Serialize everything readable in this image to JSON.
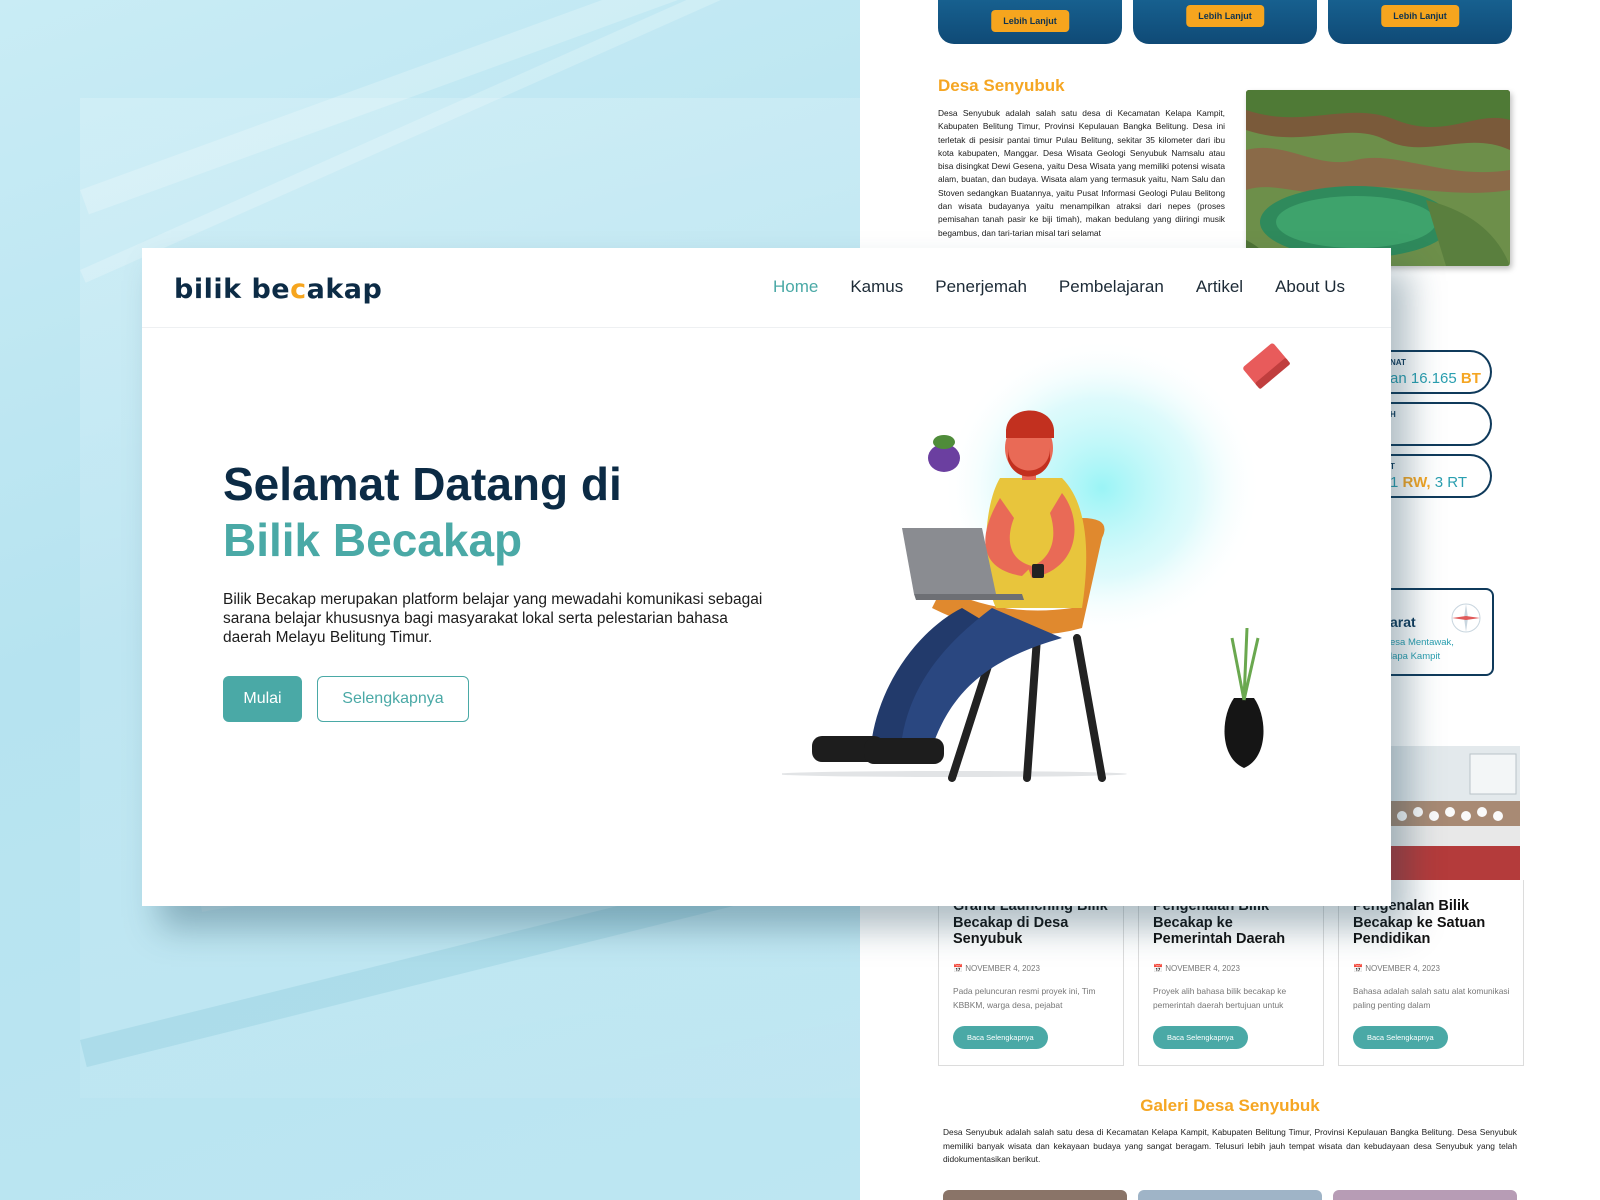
{
  "hero": {
    "logo_text_left": "bilik be",
    "logo_text_c": "c",
    "logo_text_right": "akap",
    "nav": [
      {
        "label": "Home",
        "active": true
      },
      {
        "label": "Kamus"
      },
      {
        "label": "Penerjemah"
      },
      {
        "label": "Pembelajaran"
      },
      {
        "label": "Artikel"
      },
      {
        "label": "About Us"
      }
    ],
    "title_line1": "Selamat Datang di",
    "title_line2": "Bilik Becakap",
    "description": "Bilik Becakap merupakan platform belajar yang mewadahi komunikasi sebagai sarana belajar khususnya bagi masyarakat lokal serta pelestarian bahasa daerah Melayu Belitung Timur.",
    "primary_button": "Mulai",
    "secondary_button": "Selengkapnya"
  },
  "background_page": {
    "service_cards": [
      {
        "button": "Lebih Lanjut"
      },
      {
        "button": "Lebih Lanjut"
      },
      {
        "button": "Lebih Lanjut"
      }
    ],
    "desa": {
      "title": "Desa Senyubuk",
      "text": "Desa Senyubuk adalah salah satu desa di Kecamatan Kelapa Kampit, Kabupaten Belitung Timur, Provinsi Kepulauan Bangka Belitung. Desa ini terletak di pesisir pantai timur Pulau Belitung, sekitar 35 kilometer dari ibu kota kabupaten, Manggar. Desa Wisata Geologi Senyubuk Namsalu atau bisa disingkat Dewi Gesena, yaitu Desa Wisata yang memiliki potensi wisata alam, buatan, dan budaya. Wisata alam yang termasuk yaitu, Nam Salu dan Stoven sedangkan Buatannya, yaitu Pusat Informasi Geologi Pulau Belitong dan wisata budayanya yaitu menampilkan atraksi dari nepes (proses pemisahan tanah pasir ke biji timah), makan bedulang yang diiringi musik begambus, dan tari-tarian misal tari selamat"
    },
    "stats": [
      {
        "label": "NAT",
        "value_prefix": "an ",
        "value_num": "16.165",
        "value_unit": " BT"
      },
      {
        "label": "H",
        "value_prefix": "",
        "value_num": "",
        "value_unit": ""
      },
      {
        "label": "T",
        "value_prefix": "1 ",
        "value_num": "RW,",
        "value_unit": " 3 RT"
      }
    ],
    "location": {
      "title": "arat",
      "line1": "esa Mentawak,",
      "line2": "lapa Kampit"
    },
    "news": [
      {
        "title": "Grand Launching Bilik Becakap di Desa Senyubuk",
        "date": "NOVEMBER 4, 2023",
        "excerpt": "Pada peluncuran resmi proyek ini, Tim KBBKM, warga desa, pejabat",
        "button": "Baca Selengkapnya"
      },
      {
        "title": "Pengenalan Bilik Becakap ke Pemerintah Daerah",
        "date": "NOVEMBER 4, 2023",
        "excerpt": "Proyek alih bahasa bilik becakap ke pemerintah daerah bertujuan untuk",
        "button": "Baca Selengkapnya"
      },
      {
        "title": "Pengenalan Bilik Becakap ke Satuan Pendidikan",
        "date": "NOVEMBER 4, 2023",
        "excerpt": "Bahasa adalah salah satu alat komunikasi paling penting dalam",
        "button": "Baca Selengkapnya"
      }
    ],
    "galeri": {
      "title": "Galeri Desa Senyubuk",
      "text": "Desa Senyubuk adalah salah satu desa di Kecamatan Kelapa Kampit, Kabupaten Belitung Timur, Provinsi Kepulauan Bangka Belitung. Desa Senyubuk memiliki banyak wisata dan kekayaan budaya yang sangat beragam. Telusuri lebih jauh tempat wisata dan kebudayaan desa Senyubuk yang telah didokumentasikan berikut."
    }
  },
  "colors": {
    "teal": "#4aa9a6",
    "navy": "#0c2b45",
    "orange": "#f5a623",
    "backdrop": "#bfe7f2"
  }
}
